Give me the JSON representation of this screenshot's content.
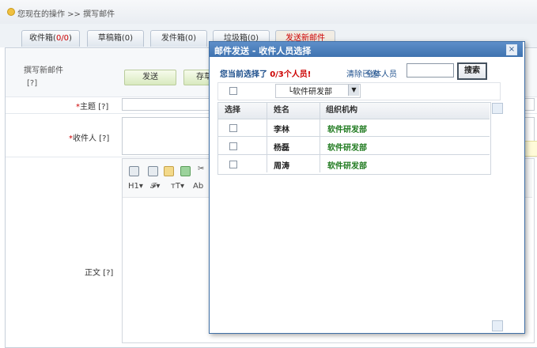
{
  "breadcrumb": {
    "text": "您现在的操作 >> 撰写邮件"
  },
  "tabs": [
    {
      "label": "收件箱(",
      "count": "0/0",
      "suffix": ")"
    },
    {
      "label": "草稿箱(0)"
    },
    {
      "label": "发件箱(0)"
    },
    {
      "label": "垃圾箱(0)"
    },
    {
      "label": "发送新邮件"
    }
  ],
  "compose": {
    "title": "撰写新邮件",
    "help": "[?]",
    "send_label": "发送",
    "save_label": "存草稿",
    "subject_label": "主题",
    "recipient_label": "收件人",
    "body_label": "正文",
    "help_marker": "[?]",
    "required_marker": "*"
  },
  "editor": {
    "heading": "H1",
    "font": "𝓕",
    "size": "ᴛT",
    "color": "Ab"
  },
  "modal": {
    "title": "邮件发送 - 收件人员选择",
    "close": "×",
    "selected_prefix": "您当前选择了",
    "selected_count": "0/3",
    "selected_suffix": "个人员!",
    "clear_label": "清除已选",
    "all_label": "全体人员",
    "search_value": "",
    "search_button": "搜索",
    "department": "└软件研发部"
  },
  "grid": {
    "headers": [
      "选择",
      "姓名",
      "组织机构"
    ],
    "rows": [
      {
        "name": "李林",
        "org": "软件研发部"
      },
      {
        "name": "杨磊",
        "org": "软件研发部"
      },
      {
        "name": "周涛",
        "org": "软件研发部"
      }
    ]
  },
  "colors": {
    "title_bar": "#3f73b0",
    "org_text": "#1f7a1f",
    "accent_red": "#cc0000"
  }
}
